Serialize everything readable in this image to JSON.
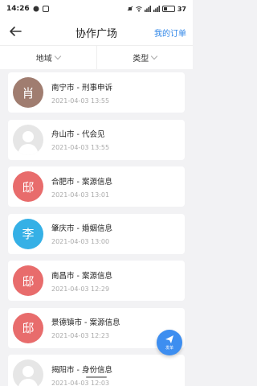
{
  "status_bar": {
    "time": "14:26",
    "battery": "37"
  },
  "header": {
    "title": "协作广场",
    "orders_label": "我的订单"
  },
  "filters": [
    {
      "label": "地域"
    },
    {
      "label": "类型"
    }
  ],
  "items": [
    {
      "avatar_text": "肖",
      "avatar_color": "#a07d70",
      "title": "南宁市 - 刑事申诉",
      "time": "2021-04-03 13:55"
    },
    {
      "avatar_text": "",
      "avatar_color": "#e6e6e6",
      "title": "舟山市 - 代会见",
      "time": "2021-04-03 13:55"
    },
    {
      "avatar_text": "邸",
      "avatar_color": "#e86c6c",
      "title": "合肥市 - 案源信息",
      "time": "2021-04-03 13:01"
    },
    {
      "avatar_text": "李",
      "avatar_color": "#35b0e6",
      "title": "肇庆市 - 婚姻信息",
      "time": "2021-04-03 13:00"
    },
    {
      "avatar_text": "邸",
      "avatar_color": "#e86c6c",
      "title": "南昌市 - 案源信息",
      "time": "2021-04-03 12:29"
    },
    {
      "avatar_text": "邸",
      "avatar_color": "#e86c6c",
      "title": "景德镇市 - 案源信息",
      "time": "2021-04-03 12:23"
    },
    {
      "avatar_text": "",
      "avatar_color": "#e6e6e6",
      "title": "揭阳市 - 身份信息",
      "time": "2021-04-03 12:03"
    }
  ],
  "fab": {
    "label": "发单"
  },
  "colors": {
    "accent": "#2f86e8",
    "fab": "#3d8ef0"
  }
}
